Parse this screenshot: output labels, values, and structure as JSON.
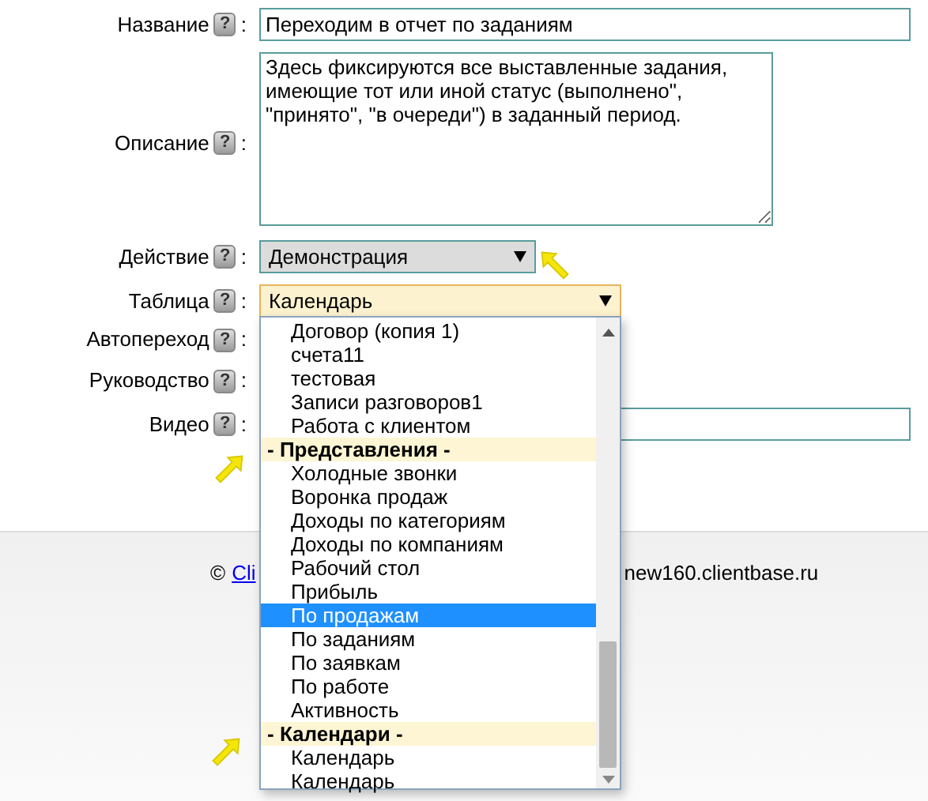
{
  "form": {
    "fields": [
      {
        "kind": "text",
        "label": "Название",
        "help": "?",
        "colon": ":",
        "value": "Переходим в отчет по заданиям"
      },
      {
        "kind": "textarea",
        "label": "Описание",
        "help": "?",
        "colon": ":",
        "value": "Здесь фиксируются все выставленные задания, имеющие тот или иной статус (выполнено\", \"принято\", \"в очереди\") в заданный период."
      },
      {
        "kind": "select",
        "label": "Действие",
        "help": "?",
        "colon": ":",
        "value": "Демонстрация",
        "highlighted": false
      },
      {
        "kind": "select",
        "label": "Таблица",
        "help": "?",
        "colon": ":",
        "value": "Календарь",
        "highlighted": true
      },
      {
        "kind": "hidden",
        "label": "Автопереход",
        "help": "?",
        "colon": ":"
      },
      {
        "kind": "hidden",
        "label": "Руководство",
        "help": "?",
        "colon": ":"
      },
      {
        "kind": "text",
        "label": "Видео",
        "help": "?",
        "colon": ":"
      }
    ]
  },
  "dropdown": {
    "options": [
      {
        "kind": "option",
        "label": "Договор (копия 1)",
        "selected": false
      },
      {
        "kind": "option",
        "label": "счета11",
        "selected": false
      },
      {
        "kind": "option",
        "label": "тестовая",
        "selected": false
      },
      {
        "kind": "option",
        "label": "Записи разговоров1",
        "selected": false
      },
      {
        "kind": "option",
        "label": "Работа с клиентом",
        "selected": false
      },
      {
        "kind": "group",
        "label": "- Представления -",
        "selected": false
      },
      {
        "kind": "option",
        "label": "Холодные звонки",
        "selected": false
      },
      {
        "kind": "option",
        "label": "Воронка продаж",
        "selected": false
      },
      {
        "kind": "option",
        "label": "Доходы по категориям",
        "selected": false
      },
      {
        "kind": "option",
        "label": "Доходы по компаниям",
        "selected": false
      },
      {
        "kind": "option",
        "label": "Рабочий стол",
        "selected": false
      },
      {
        "kind": "option",
        "label": "Прибыль",
        "selected": false
      },
      {
        "kind": "option",
        "label": "По продажам",
        "selected": true
      },
      {
        "kind": "option",
        "label": "По заданиям",
        "selected": false
      },
      {
        "kind": "option",
        "label": "По заявкам",
        "selected": false
      },
      {
        "kind": "option",
        "label": "По работе",
        "selected": false
      },
      {
        "kind": "option",
        "label": "Активность",
        "selected": false
      },
      {
        "kind": "group",
        "label": "- Календари -",
        "selected": false
      },
      {
        "kind": "option",
        "label": "Календарь",
        "selected": false
      },
      {
        "kind": "option",
        "label": "Календарь",
        "selected": false
      }
    ]
  },
  "footer": {
    "copyright": "©",
    "link": "Cli",
    "domain": "new160.clientbase.ru"
  }
}
